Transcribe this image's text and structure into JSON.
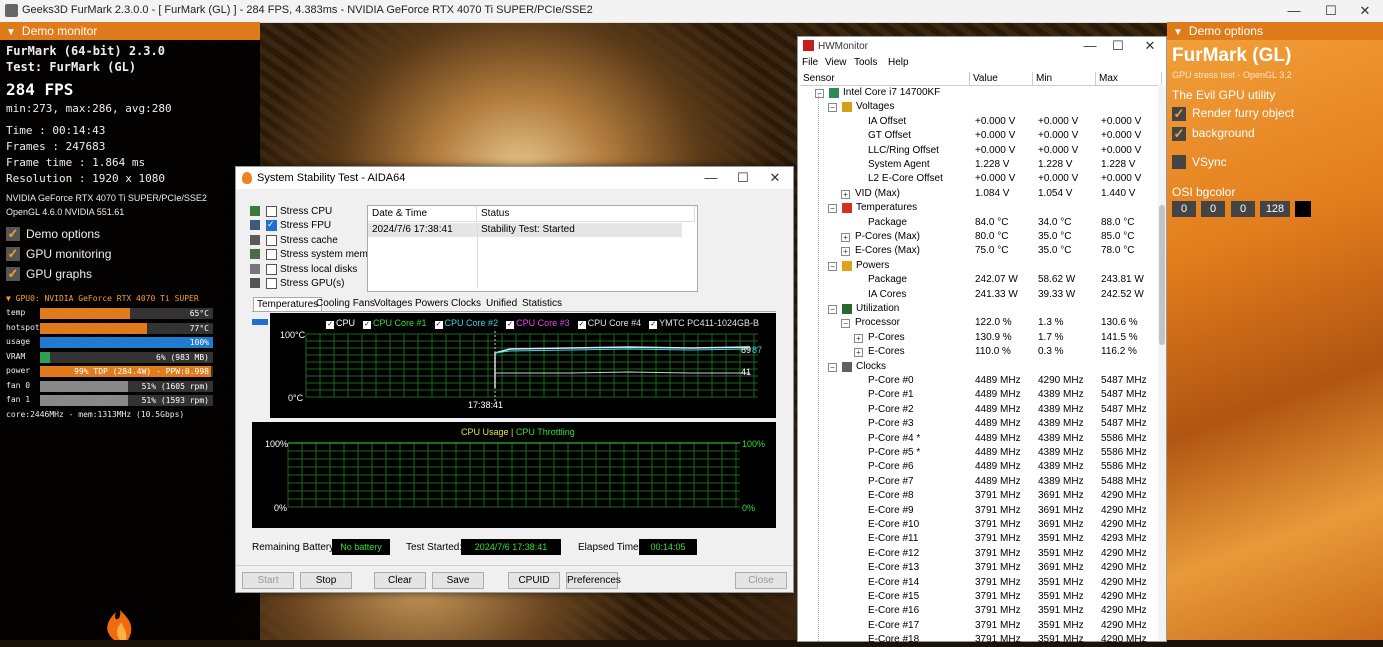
{
  "furmark_window": {
    "title": "Geeks3D FurMark 2.3.0.0 - [ FurMark (GL) ] - 284 FPS, 4.383ms - NVIDIA GeForce RTX 4070 Ti SUPER/PCIe/SSE2"
  },
  "demo_monitor": {
    "header": "Demo monitor",
    "app_line": "FurMark (64-bit) 2.3.0",
    "test_line": "Test: FurMark (GL)",
    "fps": "284 FPS",
    "fps_stats": "min:273, max:286, avg:280",
    "time": "Time       : 00:14:43",
    "frames": "Frames     : 247683",
    "frame_time": "Frame time : 1.864 ms",
    "resolution": "Resolution : 1920 x 1080",
    "gpu_line": "NVIDIA GeForce RTX 4070 Ti SUPER/PCIe/SSE2",
    "gl_line": "OpenGL 4.6.0 NVIDIA 551.61",
    "options": [
      {
        "label": "Demo options",
        "checked": true
      },
      {
        "label": "GPU monitoring",
        "checked": true
      },
      {
        "label": "GPU graphs",
        "checked": true
      }
    ],
    "gpu_header": "GPU0: NVIDIA GeForce RTX 4070 Ti SUPER",
    "bars": [
      {
        "label": "temp",
        "text": "65°C",
        "fraction": 0.52,
        "color": "#e07b1c"
      },
      {
        "label": "hotspot",
        "text": "77°C",
        "fraction": 0.62,
        "color": "#e07b1c"
      },
      {
        "label": "usage",
        "text": "100%",
        "fraction": 1.0,
        "color": "#1f7ad0"
      },
      {
        "label": "VRAM",
        "text": "6% (983 MB)",
        "fraction": 0.06,
        "color": "#2fa050"
      },
      {
        "label": "power",
        "text": "99% TDP (284.4W) - PPW:0.998",
        "fraction": 0.99,
        "color": "#e07b1c"
      },
      {
        "label": "fan 0",
        "text": "51% (1605 rpm)",
        "fraction": 0.51,
        "color": "#888888"
      },
      {
        "label": "fan 1",
        "text": "51% (1593 rpm)",
        "fraction": 0.51,
        "color": "#888888"
      }
    ],
    "clock_line": "core:2446MHz - mem:1313MHz (10.5Gbps)"
  },
  "aida": {
    "title": "System Stability Test - AIDA64",
    "stress": [
      {
        "label": "Stress CPU",
        "checked": false
      },
      {
        "label": "Stress FPU",
        "checked": true
      },
      {
        "label": "Stress cache",
        "checked": false
      },
      {
        "label": "Stress system memory",
        "checked": false
      },
      {
        "label": "Stress local disks",
        "checked": false
      },
      {
        "label": "Stress GPU(s)",
        "checked": false
      }
    ],
    "log_headers": [
      "Date & Time",
      "Status"
    ],
    "log_rows": [
      [
        "2024/7/6 17:38:41",
        "Stability Test: Started"
      ]
    ],
    "tabs": [
      "Temperatures",
      "Cooling Fans",
      "Voltages",
      "Powers",
      "Clocks",
      "Unified",
      "Statistics"
    ],
    "graph1": {
      "legend": [
        {
          "label": "CPU",
          "color": "#ffffff"
        },
        {
          "label": "CPU Core #1",
          "color": "#30e030"
        },
        {
          "label": "CPU Core #2",
          "color": "#30d8f0"
        },
        {
          "label": "CPU Core #3",
          "color": "#f040f0"
        },
        {
          "label": "CPU Core #4",
          "color": "#e0e0e0"
        },
        {
          "label": "YMTC PC411-1024GB-B",
          "color": "#e0e0e0"
        }
      ],
      "y_top": "100°C",
      "y_bottom": "0°C",
      "x_label": "17:38:41",
      "val_a": "89",
      "val_b": "87",
      "val_c": "41"
    },
    "graph2": {
      "legend_a": "CPU Usage",
      "sep": "|",
      "legend_b": "CPU Throttling",
      "left_top": "100%",
      "left_bottom": "0%",
      "right_top": "100%",
      "right_bottom": "0%"
    },
    "remaining_battery_label": "Remaining Battery:",
    "remaining_battery_value": "No battery",
    "test_started_label": "Test Started:",
    "test_started_value": "2024/7/6 17:38:41",
    "elapsed_label": "Elapsed Time:",
    "elapsed_value": "00:14:05",
    "buttons": {
      "start": "Start",
      "stop": "Stop",
      "clear": "Clear",
      "save": "Save",
      "cpuid": "CPUID",
      "preferences": "Preferences",
      "close": "Close"
    }
  },
  "hwmonitor": {
    "title": "HWMonitor",
    "menu": [
      "File",
      "View",
      "Tools",
      "Help"
    ],
    "columns": [
      "Sensor",
      "Value",
      "Min",
      "Max"
    ],
    "rows": [
      {
        "indent": 1,
        "box": "−",
        "icon": "#2e8b57",
        "name": "Intel Core i7 14700KF",
        "v": "",
        "mi": "",
        "ma": ""
      },
      {
        "indent": 2,
        "box": "−",
        "icon": "#d4a017",
        "name": "Voltages",
        "v": "",
        "mi": "",
        "ma": ""
      },
      {
        "indent": 4,
        "name": "IA Offset",
        "v": "+0.000 V",
        "mi": "+0.000 V",
        "ma": "+0.000 V"
      },
      {
        "indent": 4,
        "name": "GT Offset",
        "v": "+0.000 V",
        "mi": "+0.000 V",
        "ma": "+0.000 V"
      },
      {
        "indent": 4,
        "name": "LLC/Ring Offset",
        "v": "+0.000 V",
        "mi": "+0.000 V",
        "ma": "+0.000 V"
      },
      {
        "indent": 4,
        "name": "System Agent",
        "v": "1.228 V",
        "mi": "1.228 V",
        "ma": "1.228 V"
      },
      {
        "indent": 4,
        "name": "L2 E-Core Offset",
        "v": "+0.000 V",
        "mi": "+0.000 V",
        "ma": "+0.000 V"
      },
      {
        "indent": 3,
        "box": "+",
        "name": "VID (Max)",
        "v": "1.084 V",
        "mi": "1.054 V",
        "ma": "1.440 V"
      },
      {
        "indent": 2,
        "box": "−",
        "icon": "#d03020",
        "name": "Temperatures",
        "v": "",
        "mi": "",
        "ma": ""
      },
      {
        "indent": 4,
        "name": "Package",
        "v": "84.0 °C",
        "mi": "34.0 °C",
        "ma": "88.0 °C"
      },
      {
        "indent": 3,
        "box": "+",
        "name": "P-Cores (Max)",
        "v": "80.0 °C",
        "mi": "35.0 °C",
        "ma": "85.0 °C"
      },
      {
        "indent": 3,
        "box": "+",
        "name": "E-Cores (Max)",
        "v": "75.0 °C",
        "mi": "35.0 °C",
        "ma": "78.0 °C"
      },
      {
        "indent": 2,
        "box": "−",
        "icon": "#e0a020",
        "name": "Powers",
        "v": "",
        "mi": "",
        "ma": ""
      },
      {
        "indent": 4,
        "name": "Package",
        "v": "242.07 W",
        "mi": "58.62 W",
        "ma": "243.81 W"
      },
      {
        "indent": 4,
        "name": "IA Cores",
        "v": "241.33 W",
        "mi": "39.33 W",
        "ma": "242.52 W"
      },
      {
        "indent": 2,
        "box": "−",
        "icon": "#2a6a2a",
        "name": "Utilization",
        "v": "",
        "mi": "",
        "ma": ""
      },
      {
        "indent": 3,
        "box": "−",
        "name": "Processor",
        "v": "122.0 %",
        "mi": "1.3 %",
        "ma": "130.6 %"
      },
      {
        "indent": 4,
        "box": "+",
        "name": "P-Cores",
        "v": "130.9 %",
        "mi": "1.7 %",
        "ma": "141.5 %"
      },
      {
        "indent": 4,
        "box": "+",
        "name": "E-Cores",
        "v": "110.0 %",
        "mi": "0.3 %",
        "ma": "116.2 %"
      },
      {
        "indent": 2,
        "box": "−",
        "icon": "#606060",
        "name": "Clocks",
        "v": "",
        "mi": "",
        "ma": ""
      },
      {
        "indent": 4,
        "name": "P-Core #0",
        "v": "4489 MHz",
        "mi": "4290 MHz",
        "ma": "5487 MHz"
      },
      {
        "indent": 4,
        "name": "P-Core #1",
        "v": "4489 MHz",
        "mi": "4389 MHz",
        "ma": "5487 MHz"
      },
      {
        "indent": 4,
        "name": "P-Core #2",
        "v": "4489 MHz",
        "mi": "4389 MHz",
        "ma": "5487 MHz"
      },
      {
        "indent": 4,
        "name": "P-Core #3",
        "v": "4489 MHz",
        "mi": "4389 MHz",
        "ma": "5487 MHz"
      },
      {
        "indent": 4,
        "name": "P-Core #4 *",
        "v": "4489 MHz",
        "mi": "4389 MHz",
        "ma": "5586 MHz"
      },
      {
        "indent": 4,
        "name": "P-Core #5 *",
        "v": "4489 MHz",
        "mi": "4389 MHz",
        "ma": "5586 MHz"
      },
      {
        "indent": 4,
        "name": "P-Core #6",
        "v": "4489 MHz",
        "mi": "4389 MHz",
        "ma": "5586 MHz"
      },
      {
        "indent": 4,
        "name": "P-Core #7",
        "v": "4489 MHz",
        "mi": "4389 MHz",
        "ma": "5488 MHz"
      },
      {
        "indent": 4,
        "name": "E-Core #8",
        "v": "3791 MHz",
        "mi": "3691 MHz",
        "ma": "4290 MHz"
      },
      {
        "indent": 4,
        "name": "E-Core #9",
        "v": "3791 MHz",
        "mi": "3691 MHz",
        "ma": "4290 MHz"
      },
      {
        "indent": 4,
        "name": "E-Core #10",
        "v": "3791 MHz",
        "mi": "3691 MHz",
        "ma": "4290 MHz"
      },
      {
        "indent": 4,
        "name": "E-Core #11",
        "v": "3791 MHz",
        "mi": "3591 MHz",
        "ma": "4293 MHz"
      },
      {
        "indent": 4,
        "name": "E-Core #12",
        "v": "3791 MHz",
        "mi": "3591 MHz",
        "ma": "4290 MHz"
      },
      {
        "indent": 4,
        "name": "E-Core #13",
        "v": "3791 MHz",
        "mi": "3691 MHz",
        "ma": "4290 MHz"
      },
      {
        "indent": 4,
        "name": "E-Core #14",
        "v": "3791 MHz",
        "mi": "3591 MHz",
        "ma": "4290 MHz"
      },
      {
        "indent": 4,
        "name": "E-Core #15",
        "v": "3791 MHz",
        "mi": "3591 MHz",
        "ma": "4290 MHz"
      },
      {
        "indent": 4,
        "name": "E-Core #16",
        "v": "3791 MHz",
        "mi": "3591 MHz",
        "ma": "4290 MHz"
      },
      {
        "indent": 4,
        "name": "E-Core #17",
        "v": "3791 MHz",
        "mi": "3591 MHz",
        "ma": "4290 MHz"
      },
      {
        "indent": 4,
        "name": "E-Core #18",
        "v": "3791 MHz",
        "mi": "3591 MHz",
        "ma": "4290 MHz"
      }
    ]
  },
  "demo_options": {
    "header": "Demo options",
    "title": "FurMark (GL)",
    "subtitle": "GPU stress test - OpenGL 3.2",
    "tagline": "The Evil GPU utility",
    "render_furry": "Render furry object",
    "background": "background",
    "vsync": "VSync",
    "osi_label": "OSI bgcolor",
    "osi_values": [
      "0",
      "0",
      "0",
      "128"
    ],
    "osi_swatch": "#000000"
  }
}
